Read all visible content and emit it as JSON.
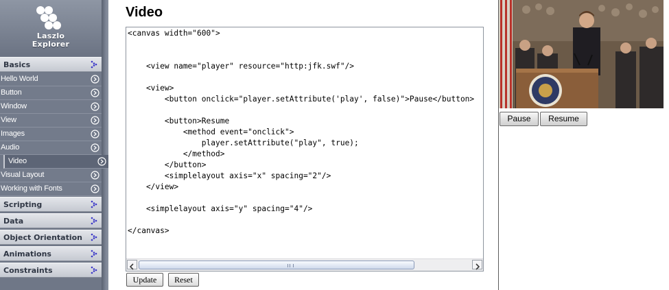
{
  "app": {
    "logo_line1": "Laszlo",
    "logo_line2": "Explorer"
  },
  "sidebar": {
    "sections": [
      {
        "label": "Basics"
      },
      {
        "label": "Scripting"
      },
      {
        "label": "Data"
      },
      {
        "label": "Object Orientation"
      },
      {
        "label": "Animations"
      },
      {
        "label": "Constraints"
      }
    ],
    "items": [
      {
        "label": "Hello World"
      },
      {
        "label": "Button"
      },
      {
        "label": "Window"
      },
      {
        "label": "View"
      },
      {
        "label": "Images"
      },
      {
        "label": "Audio"
      },
      {
        "label": "Video",
        "selected": true
      },
      {
        "label": "Visual Layout"
      },
      {
        "label": "Working with Fonts"
      }
    ]
  },
  "main": {
    "title": "Video",
    "code": "<canvas width=\"600\">\n\n\n    <view name=\"player\" resource=\"http:jfk.swf\"/>\n\n    <view>\n        <button onclick=\"player.setAttribute('play', false)\">Pause</button>\n\n        <button>Resume\n            <method event=\"onclick\">\n                player.setAttribute(\"play\", true);\n            </method>\n        </button>\n        <simplelayout axis=\"x\" spacing=\"2\"/>\n    </view>\n\n    <simplelayout axis=\"y\" spacing=\"4\"/>\n\n</canvas>",
    "update_label": "Update",
    "reset_label": "Reset"
  },
  "preview": {
    "pause_label": "Pause",
    "resume_label": "Resume"
  },
  "colors": {
    "sidebar_bg": "#6f7787",
    "section_bg": "#d4d7dd",
    "arrow": "#3a36c8",
    "item_icon": "#ffffff"
  },
  "icons": {
    "section_arrow": "dotted-chevron-right-icon",
    "item_icon": "circle-chevron-right-icon",
    "logo": "laszlo-logo-icon"
  }
}
